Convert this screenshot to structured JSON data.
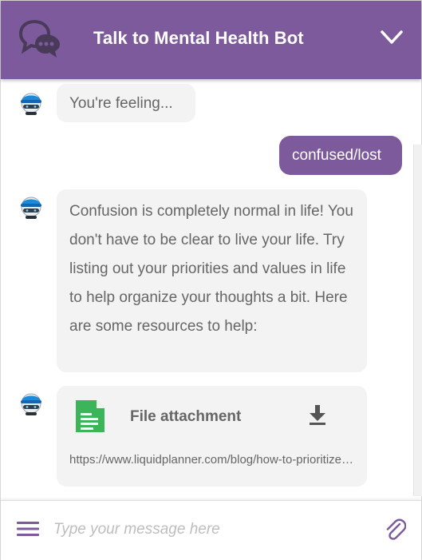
{
  "header": {
    "title": "Talk to Mental Health Bot",
    "icon": "chat-bubbles-icon",
    "collapse_icon": "chevron-down-icon",
    "background_color": "#7d5a9c"
  },
  "messages": [
    {
      "sender": "bot",
      "avatar_icon": "robot-avatar-icon",
      "text": "You're feeling..."
    },
    {
      "sender": "user",
      "text": "confused/lost"
    },
    {
      "sender": "bot",
      "avatar_icon": "robot-avatar-icon",
      "text": "Confusion is completely normal in life! You don't have to be clear to live your life. Try listing out your priorities and values in life to help organize your thoughts a bit. Here are some resources to help:"
    },
    {
      "sender": "bot",
      "avatar_icon": "robot-avatar-icon",
      "attachment": {
        "icon": "document-icon",
        "title": "File attachment",
        "download_icon": "download-icon",
        "url": "https://www.liquidplanner.com/blog/how-to-prioritize-your-life"
      }
    }
  ],
  "composer": {
    "placeholder": "Type your message here",
    "value": "",
    "menu_icon": "menu-icon",
    "attach_icon": "paperclip-icon"
  },
  "colors": {
    "accent": "#7d5a9c",
    "bot_bubble": "#f3f3f3",
    "bot_text": "#666666",
    "user_text": "#ffffff"
  }
}
